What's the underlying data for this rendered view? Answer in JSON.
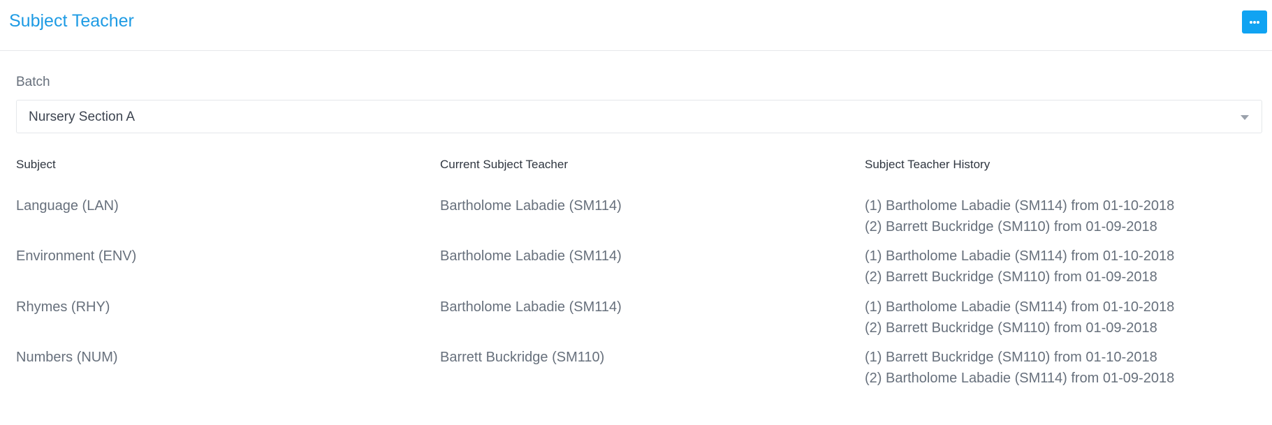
{
  "header": {
    "title": "Subject Teacher",
    "more_icon": "ellipsis-icon"
  },
  "batch": {
    "label": "Batch",
    "selected": "Nursery Section A",
    "caret_icon": "chevron-down-icon"
  },
  "table": {
    "columns": [
      "Subject",
      "Current Subject Teacher",
      "Subject Teacher History"
    ],
    "rows": [
      {
        "subject": "Language (LAN)",
        "current": "Bartholome Labadie (SM114)",
        "history": [
          "(1) Bartholome Labadie (SM114) from 01-10-2018",
          "(2) Barrett Buckridge (SM110) from 01-09-2018"
        ]
      },
      {
        "subject": "Environment (ENV)",
        "current": "Bartholome Labadie (SM114)",
        "history": [
          "(1) Bartholome Labadie (SM114) from 01-10-2018",
          "(2) Barrett Buckridge (SM110) from 01-09-2018"
        ]
      },
      {
        "subject": "Rhymes (RHY)",
        "current": "Bartholome Labadie (SM114)",
        "history": [
          "(1) Bartholome Labadie (SM114) from 01-10-2018",
          "(2) Barrett Buckridge (SM110) from 01-09-2018"
        ]
      },
      {
        "subject": "Numbers (NUM)",
        "current": "Barrett Buckridge (SM110)",
        "history": [
          "(1) Barrett Buckridge (SM110) from 01-10-2018",
          "(2) Bartholome Labadie (SM114) from 01-09-2018"
        ]
      }
    ]
  },
  "colors": {
    "accent": "#1e9be4",
    "button": "#10a3f2",
    "text_muted": "#67707c",
    "text_dark": "#2f3640"
  }
}
